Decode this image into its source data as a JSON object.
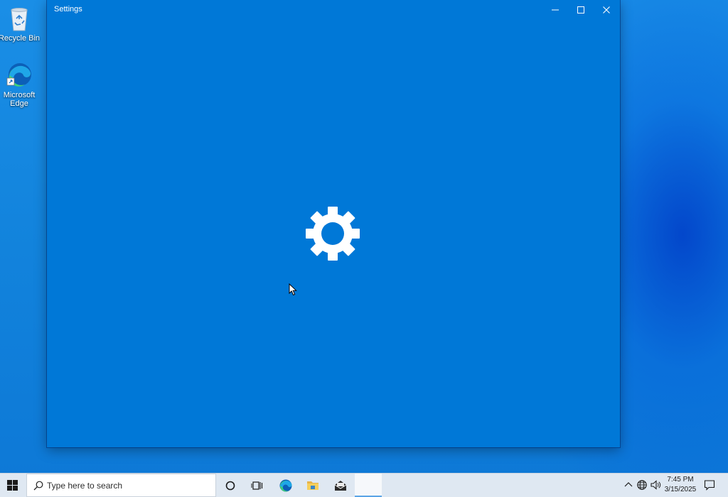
{
  "desktop": {
    "icons": [
      {
        "label": "Recycle Bin",
        "icon": "recycle-bin-icon"
      },
      {
        "label": "Microsoft Edge",
        "icon": "edge-icon"
      }
    ]
  },
  "window": {
    "title": "Settings",
    "buttons": {
      "minimize": "minimize-icon",
      "maximize": "maximize-icon",
      "close": "close-icon"
    },
    "splash_icon": "gear-icon",
    "background_color": "#0078d7"
  },
  "taskbar": {
    "search_placeholder": "Type here to search",
    "pinned": [
      "cortana-icon",
      "task-view-icon",
      "edge-icon",
      "file-explorer-icon",
      "mail-icon"
    ],
    "clock": {
      "time": "7:45 PM",
      "date": "3/15/2025"
    },
    "tray": [
      "chevron-up-icon",
      "network-globe-icon",
      "volume-icon",
      "notification-icon"
    ]
  }
}
